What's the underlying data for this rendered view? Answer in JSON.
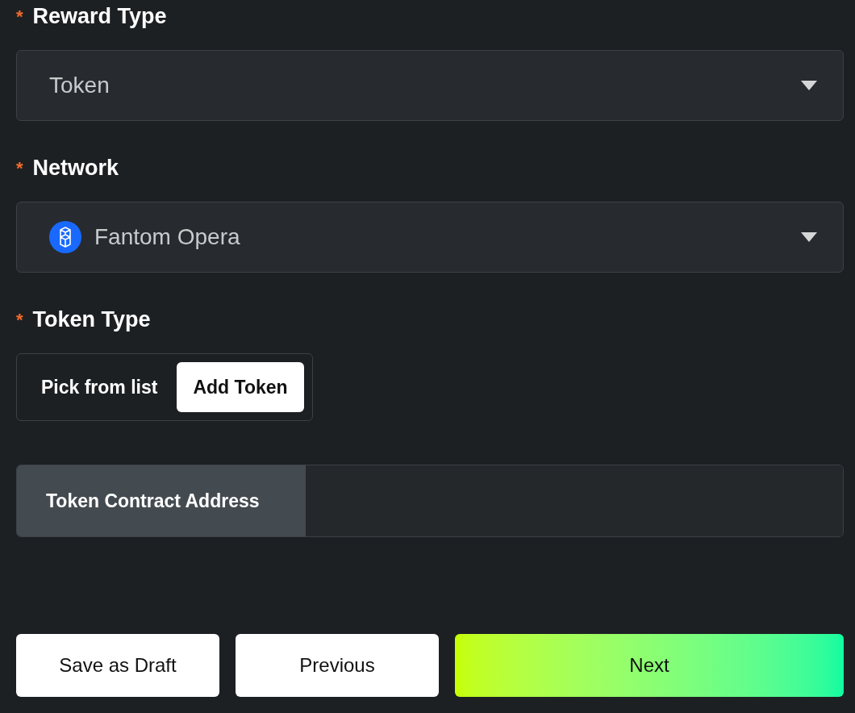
{
  "fields": [
    {
      "kind": "select",
      "label": "Reward Type",
      "required_mark": "*",
      "value": "Token"
    },
    {
      "kind": "network-select",
      "label": "Network",
      "required_mark": "*",
      "value": "Fantom Opera"
    },
    {
      "kind": "toggle",
      "label": "Token Type",
      "required_mark": "*",
      "options": [
        {
          "label": "Pick from list",
          "selected": false
        },
        {
          "label": "Add Token",
          "selected": true
        }
      ]
    },
    {
      "kind": "addon-input",
      "addon": "Token Contract Address"
    }
  ],
  "buttons": [
    {
      "label": "Save as Draft",
      "kind": "secondary"
    },
    {
      "label": "Previous",
      "kind": "secondary"
    },
    {
      "label": "Next",
      "kind": "primary"
    }
  ]
}
